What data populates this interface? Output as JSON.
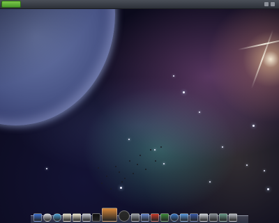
{
  "top_panel": {
    "menu_label": "",
    "clock": ""
  },
  "dock": {
    "items": [
      {
        "name": "finder-icon",
        "color": "#3a6fd0"
      },
      {
        "name": "clock-icon",
        "color": "#d8d8dc"
      },
      {
        "name": "compass-icon",
        "color": "#4aa0d8"
      },
      {
        "name": "calendar-icon",
        "color": "#e8e2cf"
      },
      {
        "name": "notes-icon",
        "color": "#f1ead3"
      },
      {
        "name": "mail-icon",
        "color": "#c7cbd4"
      },
      {
        "name": "terminal-icon",
        "color": "#101010"
      },
      {
        "name": "photo-icon",
        "color": "#d9893a"
      },
      {
        "name": "dvd-icon",
        "color": "#2a2a2a"
      },
      {
        "name": "settings-icon",
        "color": "#a0a4ac"
      },
      {
        "name": "moon-icon",
        "color": "#6a8ad0"
      },
      {
        "name": "red-app-icon",
        "color": "#c83a2a"
      },
      {
        "name": "tree-icon",
        "color": "#3c8a3a"
      },
      {
        "name": "globe-icon",
        "color": "#3a78c8"
      },
      {
        "name": "chat-icon",
        "color": "#5a9ae0"
      },
      {
        "name": "dashboard-icon",
        "color": "#3a5aa8"
      },
      {
        "name": "apps-icon",
        "color": "#d0d4dc"
      },
      {
        "name": "camera-icon",
        "color": "#8a9098"
      },
      {
        "name": "network-icon",
        "color": "#6a9a8a"
      },
      {
        "name": "trash-icon",
        "color": "#b8bcc4"
      }
    ]
  }
}
